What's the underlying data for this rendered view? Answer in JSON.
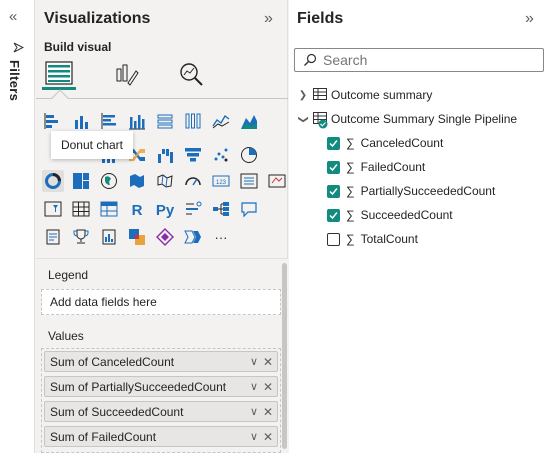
{
  "filters": {
    "label": "Filters",
    "collapse_glyph": "«",
    "icon": "funnel-icon"
  },
  "visualizations": {
    "title": "Visualizations",
    "expand_glyph": "»",
    "build_visual_label": "Build visual",
    "tooltip": "Donut chart",
    "more_glyph": "···",
    "legend_label": "Legend",
    "legend_placeholder": "Add data fields here",
    "values_label": "Values",
    "values": [
      {
        "label": "Sum of CanceledCount"
      },
      {
        "label": "Sum of PartiallySucceededCount"
      },
      {
        "label": "Sum of SucceededCount"
      },
      {
        "label": "Sum of FailedCount"
      }
    ],
    "pill_chevron": "∨",
    "pill_remove": "✕"
  },
  "fields": {
    "title": "Fields",
    "expand_glyph": "»",
    "search_placeholder": "Search",
    "tables": [
      {
        "name": "Outcome summary",
        "expanded": false
      },
      {
        "name": "Outcome Summary Single Pipeline",
        "expanded": true
      }
    ],
    "columns": [
      {
        "name": "CanceledCount",
        "checked": true
      },
      {
        "name": "FailedCount",
        "checked": true
      },
      {
        "name": "PartiallySucceededCount",
        "checked": true
      },
      {
        "name": "SucceededCount",
        "checked": true
      },
      {
        "name": "TotalCount",
        "checked": false
      }
    ],
    "sigma_glyph": "∑"
  },
  "colors": {
    "accent": "#118b7f",
    "pane_bg": "#f3f2f1",
    "fields_bg": "#ffffff",
    "icon_blue": "#1c6ebc"
  }
}
